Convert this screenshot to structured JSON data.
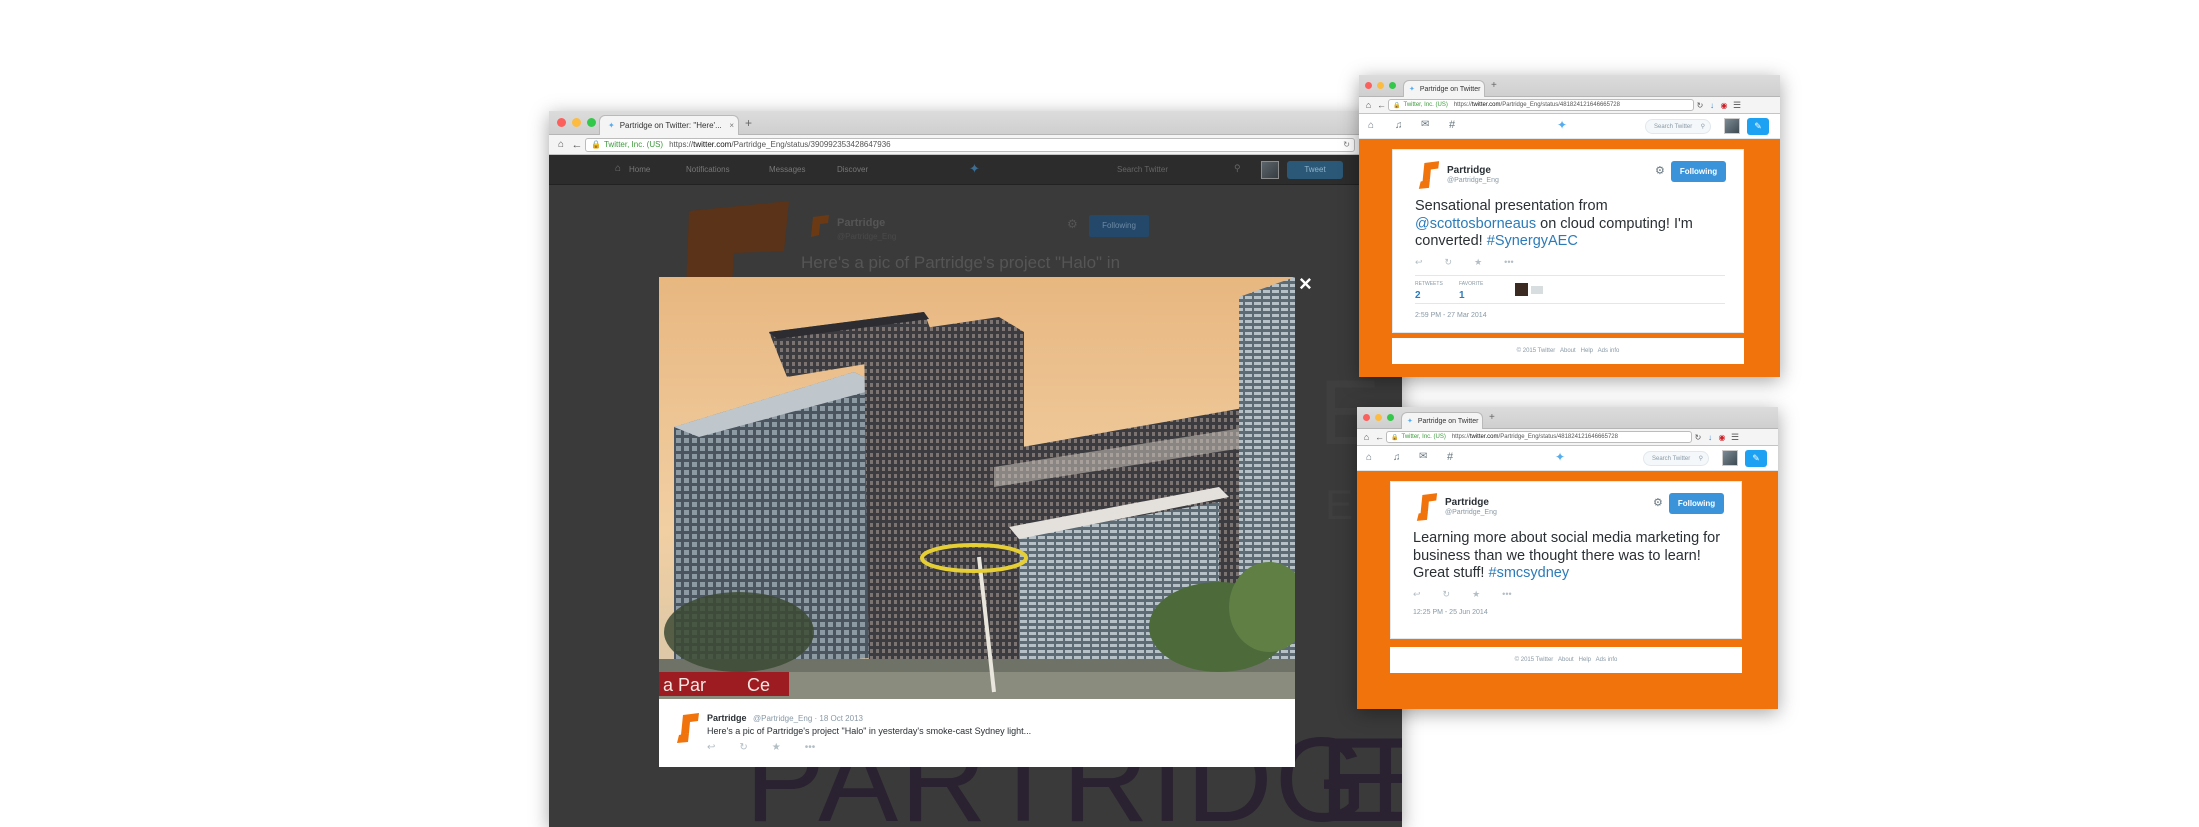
{
  "colors": {
    "twitter_blue": "#55acee",
    "link_blue": "#2b7bb9",
    "orange": "#f0730b",
    "ev_green": "#3b9b3b"
  },
  "left_window": {
    "tab_title": "Partridge on Twitter: \"Here'...",
    "tab_close": "×",
    "new_tab": "+",
    "ev_label": "Twitter, Inc. (US)",
    "url_prefix": "https://",
    "url_host": "twitter.com",
    "url_path": "/Partridge_Eng/status/390992353428647936",
    "nav": {
      "home": "Home",
      "notifications": "Notifications",
      "messages": "Messages",
      "discover": "Discover",
      "search_placeholder": "Search Twitter",
      "tweet": "Tweet"
    },
    "bg_tweet": {
      "name": "Partridge",
      "handle": "@Partridge_Eng",
      "following": "Following",
      "text": "Here's a pic of Partridge's project \"Halo\" in",
      "bg_word": "PARTRIDGE"
    },
    "modal": {
      "close": "×",
      "name": "Partridge",
      "meta": "@Partridge_Eng · 18 Oct 2013",
      "text": "Here's a pic of Partridge's project \"Halo\" in yesterday's smoke-cast Sydney light...",
      "photo_signage_1": "a Par",
      "photo_signage_2": "Ce"
    }
  },
  "top_right_window": {
    "tab_title": "Partridge on Twitter",
    "tab_close": "×",
    "new_tab": "+",
    "ev_label": "Twitter, Inc. (US)",
    "url_prefix": "https://",
    "url_host": "twitter.com",
    "url_path": "/Partridge_Eng/status/481824121646665728",
    "search_placeholder": "Search Twitter",
    "tweet": {
      "name": "Partridge",
      "handle": "@Partridge_Eng",
      "following": "Following",
      "text_1": "Sensational presentation from",
      "mention": "@scottosborneaus",
      "text_2": " on cloud computing! I'm converted! ",
      "hashtag": "#SynergyAEC",
      "retweets_label": "RETWEETS",
      "retweets": "2",
      "favorites_label": "FAVORITE",
      "favorites": "1",
      "timestamp": "2:59 PM - 27 Mar 2014"
    },
    "footer": "© 2015 Twitter   About   Help   Ads info"
  },
  "bottom_right_window": {
    "tab_title": "Partridge on Twitter",
    "tab_close": "×",
    "new_tab": "+",
    "ev_label": "Twitter, Inc. (US)",
    "url_prefix": "https://",
    "url_host": "twitter.com",
    "url_path": "/Partridge_Eng/status/481824121646665728",
    "search_placeholder": "Search Twitter",
    "tweet": {
      "name": "Partridge",
      "handle": "@Partridge_Eng",
      "following": "Following",
      "text_1": "Learning more about social media marketing for business than we thought there was to learn! Great stuff! ",
      "hashtag": "#smcsydney",
      "timestamp": "12:25 PM - 25 Jun 2014"
    },
    "footer": "© 2015 Twitter   About   Help   Ads info"
  }
}
